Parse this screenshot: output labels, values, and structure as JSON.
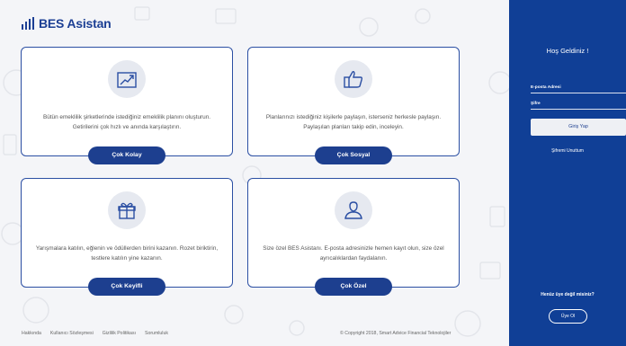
{
  "brand": {
    "name": "BES Asistan",
    "color": "#1c3f94"
  },
  "cards": [
    {
      "icon": "growth-chart-icon",
      "description": "Bütün emeklilik şirketlerinde istediğiniz emeklilik planını oluşturun. Getirilerini çok hızlı ve anında karşılaştırın.",
      "button": "Çok Kolay"
    },
    {
      "icon": "thumbs-up-icon",
      "description": "Planlarınızı istediğiniz kişilerle paylaşın, isterseniz herkesle paylaşın. Paylaşılan planları takip edin, inceleyin.",
      "button": "Çok Sosyal"
    },
    {
      "icon": "gift-icon",
      "description": "Yarışmalara katılın, eğlenin ve ödüllerden birini kazanın. Rozet biriktirin, testlere katılın yine kazanın.",
      "button": "Çok Keyifli"
    },
    {
      "icon": "user-icon",
      "description": "Size özel BES Asistanı. E-posta adresinizle hemen kayıt olun, size özel ayrıcalıklardan faydalanın.",
      "button": "Çok Özel"
    }
  ],
  "footer": {
    "links": [
      "Hakkında",
      "Kullanıcı Sözleşmesi",
      "Gizlilik Politikası",
      "Sorumluluk"
    ],
    "copyright": "© Copyright 2018, Smart Advice Financial Teknolojiler"
  },
  "sidebar": {
    "welcome": "Hoş Geldiniz !",
    "email_label": "E-posta Adresi",
    "password_label": "Şifre",
    "login_button": "Giriş Yap",
    "forgot_link": "Şifremi Unuttum",
    "not_member": "Henüz üye değil misiniz?",
    "register_button": "Üye Ol",
    "color": "#103f96"
  }
}
